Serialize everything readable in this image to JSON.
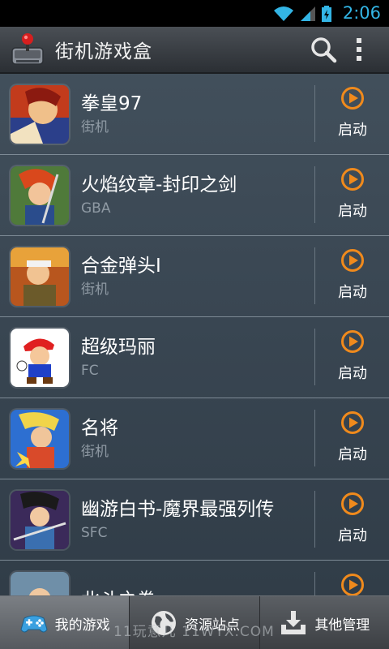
{
  "status_bar": {
    "time": "2:06",
    "icons": [
      "wifi-icon",
      "signal-icon",
      "battery-icon"
    ]
  },
  "action_bar": {
    "title": "街机游戏盒",
    "icons": [
      "app-logo-icon",
      "search-icon",
      "overflow-menu-icon"
    ]
  },
  "games": [
    {
      "name": "拳皇97",
      "type": "街机",
      "launch_label": "启动"
    },
    {
      "name": "火焰纹章-封印之剑",
      "type": "GBA",
      "launch_label": "启动"
    },
    {
      "name": "合金弹头I",
      "type": "街机",
      "launch_label": "启动"
    },
    {
      "name": "超级玛丽",
      "type": "FC",
      "launch_label": "启动"
    },
    {
      "name": "名将",
      "type": "街机",
      "launch_label": "启动"
    },
    {
      "name": "幽游白书-魔界最强列传",
      "type": "SFC",
      "launch_label": "启动"
    },
    {
      "name": "北斗之拳",
      "type": "",
      "launch_label": "启动"
    }
  ],
  "tabs": [
    {
      "label": "我的游戏",
      "icon": "gamepad-icon",
      "active": true
    },
    {
      "label": "资源站点",
      "icon": "globe-icon",
      "active": false
    },
    {
      "label": "其他管理",
      "icon": "download-tray-icon",
      "active": false
    }
  ],
  "watermark": "11玩意儿  11WYX.COM",
  "colors": {
    "accent_orange": "#f08a1c",
    "clock_blue": "#33b5e5"
  }
}
